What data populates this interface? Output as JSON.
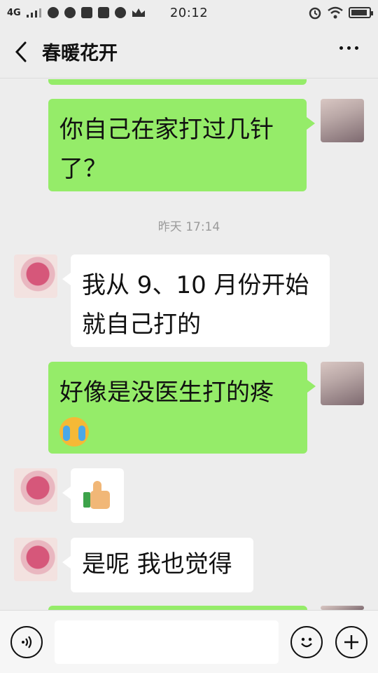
{
  "status_bar": {
    "network": "4G",
    "time": "20:12"
  },
  "header": {
    "title": "春暖花开"
  },
  "messages": [
    {
      "sender": "me",
      "text": "你自己在家打过几针了？"
    },
    {
      "type": "timestamp",
      "text": "昨天 17:14"
    },
    {
      "sender": "other",
      "text_line1": "我从 9、10 月份开始",
      "text_line2": "就自己打的"
    },
    {
      "sender": "me",
      "text": "好像是没医生打的疼",
      "emoji": "loudly-crying-face"
    },
    {
      "sender": "other",
      "emoji": "thumbs-up"
    },
    {
      "sender": "other",
      "text": "是呢  我也觉得"
    }
  ],
  "colors": {
    "my_bubble": "#95ec69",
    "other_bubble": "#ffffff",
    "background": "#ededed"
  },
  "icons": {
    "back": "chevron-left-icon",
    "more": "more-dots-icon",
    "voice": "voice-icon",
    "emoji": "smile-icon",
    "plus": "plus-icon"
  }
}
